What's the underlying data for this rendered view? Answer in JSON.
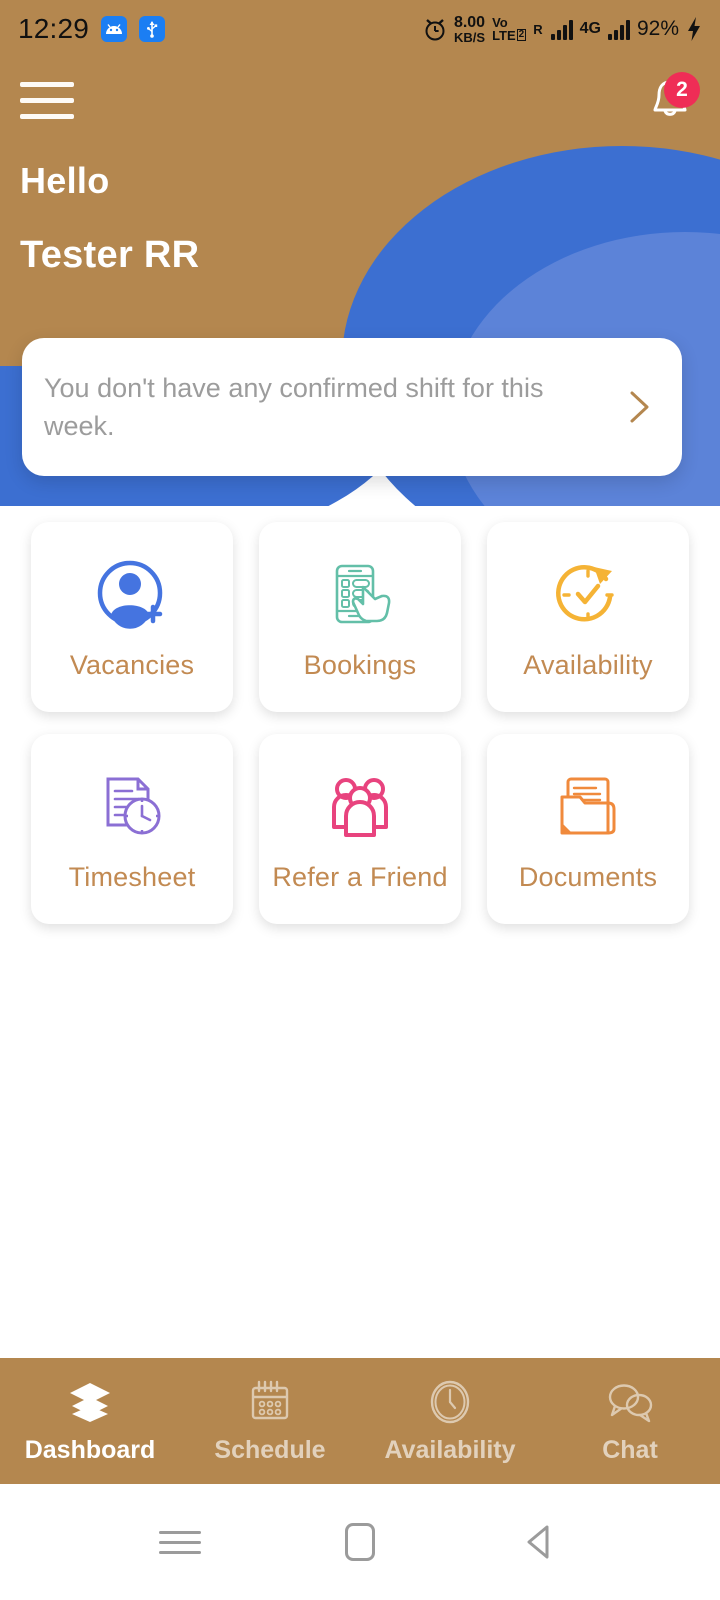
{
  "status_bar": {
    "clock": "12:29",
    "left_icons": [
      "android-icon",
      "usb-icon"
    ],
    "alarm_icon": "alarm-icon",
    "net_speed_value": "8.00",
    "net_speed_unit": "KB/S",
    "volte_line1": "Vo",
    "volte_line2": "LTE",
    "sim_badge": "2",
    "roaming": "R",
    "network_type": "4G",
    "battery": "92%",
    "charging_icon": "charging-bolt-icon"
  },
  "header": {
    "menu_icon": "hamburger-menu-icon",
    "bell_icon": "notification-bell-icon",
    "bell_badge_count": "2",
    "greeting": "Hello",
    "user_name": "Tester RR",
    "bg_color": "#b4874f",
    "blob_dark": "#3c6fd1",
    "blob_light": "#5c83d8"
  },
  "shift_notice": {
    "message": "You don't have any confirmed shift for this week.",
    "chevron_icon": "chevron-right-icon",
    "chevron_color": "#b4874f"
  },
  "tiles": [
    {
      "label": "Vacancies",
      "icon": "person-add-circle-icon",
      "color": "#4574e0"
    },
    {
      "label": "Bookings",
      "icon": "phone-tap-hand-icon",
      "color": "#63bfa8"
    },
    {
      "label": "Availability",
      "icon": "clock-refresh-check-icon",
      "color": "#f5b335"
    },
    {
      "label": "Timesheet",
      "icon": "document-clock-icon",
      "color": "#8b6fd4"
    },
    {
      "label": "Refer a Friend",
      "icon": "people-group-icon",
      "color": "#e8437e"
    },
    {
      "label": "Documents",
      "icon": "folder-documents-icon",
      "color": "#f08a3c"
    }
  ],
  "bottom_nav": {
    "active_index": 0,
    "items": [
      {
        "label": "Dashboard",
        "icon": "layers-stack-icon"
      },
      {
        "label": "Schedule",
        "icon": "calendar-icon"
      },
      {
        "label": "Availability",
        "icon": "clock-icon"
      },
      {
        "label": "Chat",
        "icon": "chat-bubbles-icon"
      }
    ]
  },
  "system_nav": {
    "recents": "recents-icon",
    "home": "home-icon",
    "back": "back-icon"
  }
}
